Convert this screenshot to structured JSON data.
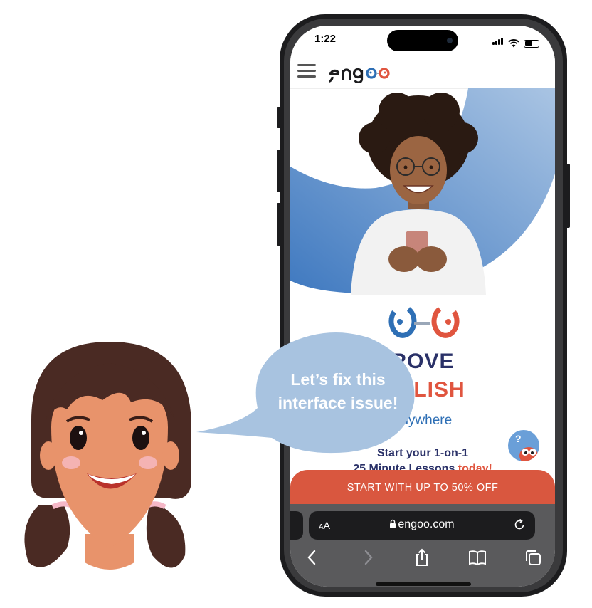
{
  "status_bar": {
    "time": "1:22"
  },
  "site": {
    "logo": "engoo",
    "headline_line1": "ROVE",
    "headline_line2": "NGLISH",
    "subheadline": "anywhere",
    "start_line1": "Start your 1-on-1",
    "start_line2_prefix": "25 Minute Lessons ",
    "start_line2_highlight": "today!",
    "cta_label": "START WITH UP TO 50% OFF",
    "help_button_mark": "?"
  },
  "browser": {
    "text_size_label_small": "A",
    "text_size_label": "A",
    "url": "engoo.com",
    "toolbar": [
      "back-icon",
      "forward-icon",
      "share-icon",
      "bookmarks-icon",
      "tabs-icon"
    ]
  },
  "speech_bubble": {
    "line1": "Let’s fix this",
    "line2": "interface issue!"
  },
  "colors": {
    "brand_blue": "#2e6fb5",
    "brand_orange": "#e0553f",
    "navy": "#2a3168",
    "bubble": "#a8c3e0"
  }
}
